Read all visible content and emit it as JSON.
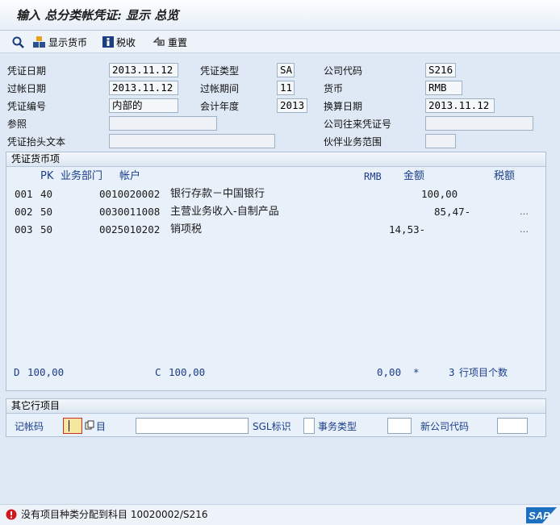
{
  "window": {
    "title": "输入 总分类帐凭证: 显示 总览"
  },
  "toolbar": {
    "show_currency_label": "显示货币",
    "tax_label": "税收",
    "reset_label": "重置"
  },
  "header": {
    "doc_date": {
      "label": "凭证日期",
      "value": "2013.11.12"
    },
    "doc_type": {
      "label": "凭证类型",
      "value": "SA"
    },
    "company_code": {
      "label": "公司代码",
      "value": "S216"
    },
    "posting_date": {
      "label": "过帐日期",
      "value": "2013.11.12"
    },
    "period": {
      "label": "过帐期间",
      "value": "11"
    },
    "currency": {
      "label": "货币",
      "value": "RMB"
    },
    "doc_number": {
      "label": "凭证编号",
      "value": "内部的"
    },
    "fiscal_year": {
      "label": "会计年度",
      "value": "2013"
    },
    "translation_date": {
      "label": "换算日期",
      "value": "2013.11.12"
    },
    "reference": {
      "label": "参照",
      "value": ""
    },
    "intercompany": {
      "label": "公司往来凭证号",
      "value": ""
    },
    "header_text": {
      "label": "凭证抬头文本",
      "value": ""
    },
    "partner_ba": {
      "label": "伙伴业务范围",
      "value": ""
    }
  },
  "items_panel": {
    "title": "凭证货币项",
    "columns": {
      "pk": "PK",
      "ba": "业务部门",
      "account": "帐户",
      "currency": "RMB",
      "amount": "金额",
      "tax": "税额"
    },
    "rows": [
      {
        "item": "001",
        "pk": "40",
        "account": "0010020002",
        "desc": "银行存款－中国银行",
        "amount": "100,00",
        "tax": ""
      },
      {
        "item": "002",
        "pk": "50",
        "account": "0030011008",
        "desc": "主营业务收入-自制产品",
        "amount": "85,47-",
        "tax": "…"
      },
      {
        "item": "003",
        "pk": "50",
        "account": "0025010202",
        "desc": "销项税",
        "amount": "14,53-",
        "tax": "…"
      }
    ],
    "totals": {
      "debit_label": "D",
      "debit": "100,00",
      "credit_label": "C",
      "credit": "100,00",
      "balance": "0,00",
      "balance_flag": "*",
      "count": "3",
      "count_label": "行项目个数"
    }
  },
  "other_panel": {
    "title": "其它行项目",
    "posting_key_label": "记帐码",
    "account_label": "目",
    "sgl_label": "SGL标识",
    "trans_type_label": "事务类型",
    "new_company_label": "新公司代码"
  },
  "status": {
    "message": "没有项目种类分配到科目 10020002/S216"
  },
  "colors": {
    "background": "#dfe9f5",
    "accent_blue": "#1b3d8a",
    "error_red": "#d4161c",
    "sap_blue": "#1d6fc0"
  }
}
